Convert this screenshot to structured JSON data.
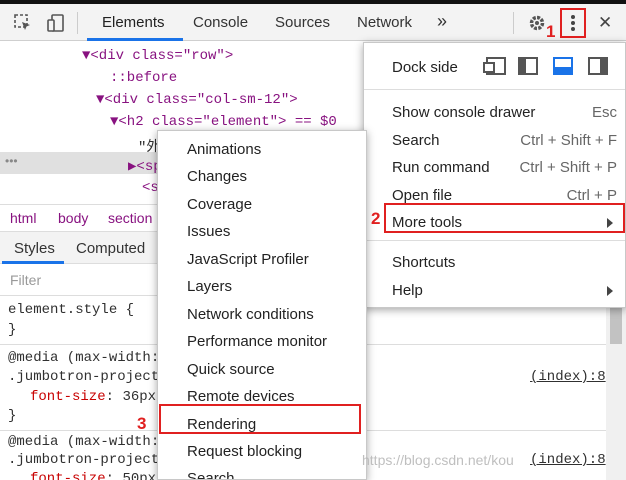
{
  "toolbar": {
    "tabs": [
      "Elements",
      "Console",
      "Sources",
      "Network"
    ],
    "more_tabs": "»",
    "close": "✕"
  },
  "dom": {
    "lines": [
      {
        "text": "▼<div class=\"row\">"
      },
      {
        "text": "::before"
      },
      {
        "text": "▼<div class=\"col-sm-12\">"
      },
      {
        "text": "▼<h2 class=\"element\"> == $0"
      },
      {
        "text": "\"外"
      },
      {
        "text": "▶<sp"
      },
      {
        "text": "<s"
      }
    ],
    "ellipsis": "•••"
  },
  "breadcrumb": [
    "html",
    "body",
    "section"
  ],
  "styles_tabs": [
    "Styles",
    "Computed"
  ],
  "filter_placeholder": "Filter",
  "styles": {
    "element_style": "element.style {",
    "close_brace": "}",
    "media1": "@media (max-width:",
    "selector1": ".jumbotron-project",
    "prop1_name": "font-size",
    "prop1_value": "36px",
    "media2": "@media (max-width:",
    "selector2": ".jumbotron-project",
    "prop2_name": "font-size",
    "prop2_value": "50px",
    "source1": "(index):8",
    "source2": "(index):8"
  },
  "main_menu": {
    "dock_side": "Dock side",
    "items": [
      {
        "label": "Show console drawer",
        "shortcut": "Esc"
      },
      {
        "label": "Search",
        "shortcut": "Ctrl + Shift + F"
      },
      {
        "label": "Run command",
        "shortcut": "Ctrl + Shift + P"
      },
      {
        "label": "Open file",
        "shortcut": "Ctrl + P"
      },
      {
        "label": "More tools",
        "shortcut": ""
      },
      {
        "label": "Shortcuts",
        "shortcut": ""
      },
      {
        "label": "Help",
        "shortcut": ""
      }
    ]
  },
  "sub_menu": {
    "items": [
      "Animations",
      "Changes",
      "Coverage",
      "Issues",
      "JavaScript Profiler",
      "Layers",
      "Network conditions",
      "Performance monitor",
      "Quick source",
      "Remote devices",
      "Rendering",
      "Request blocking",
      "Search"
    ]
  },
  "annotations": [
    "1",
    "2",
    "3"
  ],
  "watermark": "https://blog.csdn.net/kou...(partially hidden)...36",
  "colors": {
    "accent": "#1a73e8",
    "annotation": "#e02020"
  }
}
